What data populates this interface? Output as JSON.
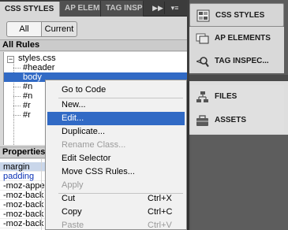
{
  "panel": {
    "tabs": [
      "CSS STYLES",
      "AP ELEMENTS",
      "TAG INSPECTOR"
    ],
    "expand_glyph": "▶▶",
    "menu_glyph": "▾≡",
    "toggle_all": "All",
    "toggle_current": "Current",
    "rules_header": "All Rules",
    "tree_toggle": "−",
    "tree": {
      "root": "styles.css",
      "items": [
        "#header",
        "body",
        "#n",
        "#n",
        "#r",
        "#r"
      ]
    },
    "props_header": "Properties",
    "props": [
      "margin",
      "padding",
      "-moz-appe",
      "-moz-back",
      "-moz-back",
      "-moz-back",
      "-moz-back"
    ]
  },
  "dock": {
    "top": [
      {
        "label": "CSS STYLES",
        "icon": "css-styles-icon"
      },
      {
        "label": "AP ELEMENTS",
        "icon": "ap-elements-icon"
      },
      {
        "label": "TAG INSPEC...",
        "icon": "tag-inspector-icon"
      }
    ],
    "bottom": [
      {
        "label": "FILES",
        "icon": "files-icon"
      },
      {
        "label": "ASSETS",
        "icon": "assets-icon"
      }
    ]
  },
  "context_menu": {
    "items": [
      {
        "label": "Go to Code",
        "shortcut": "",
        "state": "normal"
      },
      {
        "label": "New...",
        "shortcut": "",
        "state": "normal"
      },
      {
        "label": "Edit...",
        "shortcut": "",
        "state": "highlighted"
      },
      {
        "label": "Duplicate...",
        "shortcut": "",
        "state": "normal"
      },
      {
        "label": "Rename Class...",
        "shortcut": "",
        "state": "disabled"
      },
      {
        "label": "Edit Selector",
        "shortcut": "",
        "state": "normal"
      },
      {
        "label": "Move CSS Rules...",
        "shortcut": "",
        "state": "normal"
      },
      {
        "label": "Apply",
        "shortcut": "",
        "state": "disabled"
      },
      {
        "label": "Cut",
        "shortcut": "Ctrl+X",
        "state": "normal"
      },
      {
        "label": "Copy",
        "shortcut": "Ctrl+C",
        "state": "normal"
      },
      {
        "label": "Paste",
        "shortcut": "Ctrl+V",
        "state": "disabled"
      }
    ]
  },
  "colors": {
    "selection": "#316ac5",
    "dock_background": "#5d5d5d",
    "panel_background": "#d8d8d8"
  }
}
